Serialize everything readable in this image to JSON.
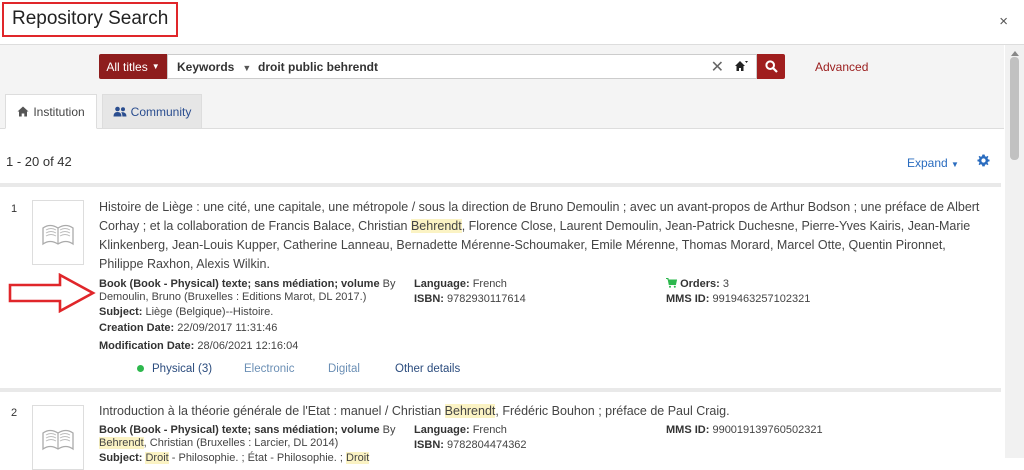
{
  "dialog": {
    "title": "Repository Search",
    "close": "×"
  },
  "search": {
    "scope": "All titles",
    "field": "Keywords",
    "query": "droit public behrendt",
    "clear": "✕",
    "advanced": "Advanced"
  },
  "tabs": [
    {
      "label": "Institution",
      "icon": "home-icon"
    },
    {
      "label": "Community",
      "icon": "users-icon"
    }
  ],
  "results_summary": "1 - 20 of 42",
  "expand_label": "Expand",
  "results": [
    {
      "number": "1",
      "title_parts": [
        "Histoire de Liège : une cité, une capitale, une métropole / sous la direction de Bruno Demoulin ; avec un avant-propos de Arthur Bodson ; une préface de Albert Corhay ; et la collaboration de Francis Balace, Christian ",
        "Behrendt",
        ", Florence Close, Laurent Demoulin, Jean-Patrick Duchesne, Pierre-Yves Kairis, Jean-Marie Klinkenberg, Jean-Louis Kupper, Catherine Lanneau, Bernadette Mérenne-Schoumaker, Emile Mérenne, Thomas Morard, Marcel Otte, Quentin Pironnet, Philippe Raxhon, Alexis Wilkin."
      ],
      "type": "Book (Book - Physical) texte; sans médiation; volume",
      "by_label": "By",
      "by": "Demoulin, Bruno (Bruxelles : Editions Marot, DL 2017.)",
      "subject_label": "Subject:",
      "subject": "Liège (Belgique)--Histoire.",
      "creation_label": "Creation Date:",
      "creation": "22/09/2017 11:31:46",
      "modification_label": "Modification Date:",
      "modification": "28/06/2021 12:16:04",
      "language_label": "Language:",
      "language": "French",
      "isbn_label": "ISBN:",
      "isbn": "9782930117614",
      "orders_label": "Orders:",
      "orders": "3",
      "mms_label": "MMS ID:",
      "mms": "9919463257102321",
      "links": {
        "physical": "Physical (3)",
        "electronic": "Electronic",
        "digital": "Digital",
        "other": "Other details"
      }
    },
    {
      "number": "2",
      "title_parts": [
        "Introduction à la théorie générale de l'Etat : manuel / Christian ",
        "Behrendt",
        ", Frédéric Bouhon ; préface de Paul Craig."
      ],
      "type": "Book (Book - Physical) texte; sans médiation; volume",
      "by_label": "By",
      "by_hl": "Behrendt",
      "by_rest": ", Christian (Bruxelles : Larcier, DL 2014)",
      "subject_label": "Subject:",
      "subject_parts": [
        "Droit",
        " - Philosophie. ; État - Philosophie. ; ",
        "Droit"
      ],
      "language_label": "Language:",
      "language": "French",
      "isbn_label": "ISBN:",
      "isbn": "9782804474362",
      "mms_label": "MMS ID:",
      "mms": "990019139760502321"
    }
  ],
  "colors": {
    "brand": "#8e1d1d",
    "link": "#2a6cbf",
    "highlight": "#fbf3c4",
    "annotation": "#e0262a"
  }
}
